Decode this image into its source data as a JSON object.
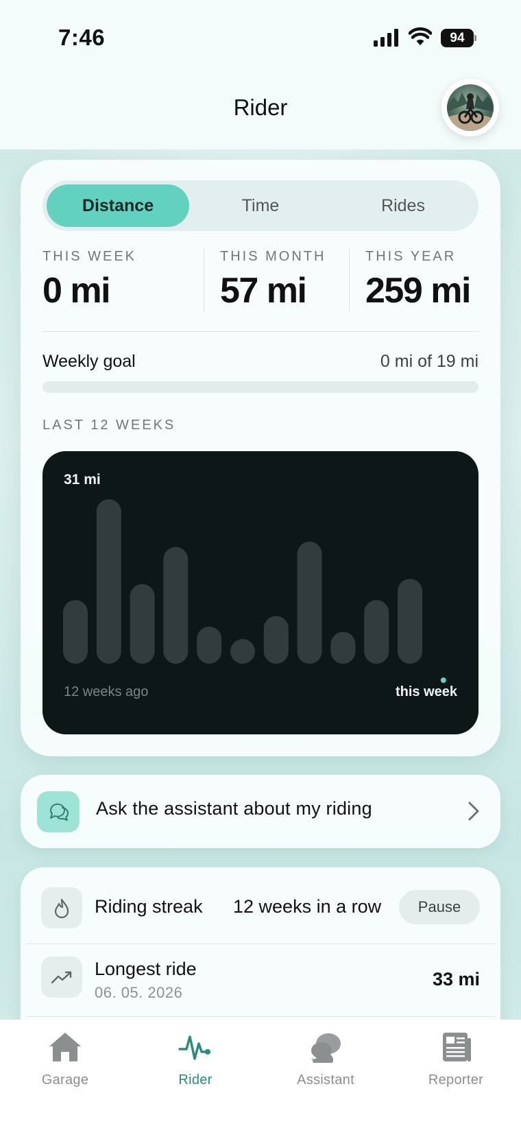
{
  "status_bar": {
    "time": "7:46",
    "battery": "94"
  },
  "header": {
    "title": "Rider"
  },
  "segments": [
    {
      "label": "Distance",
      "active": true
    },
    {
      "label": "Time",
      "active": false
    },
    {
      "label": "Rides",
      "active": false
    }
  ],
  "stats": [
    {
      "label": "THIS WEEK",
      "value": "0 mi"
    },
    {
      "label": "THIS MONTH",
      "value": "57 mi"
    },
    {
      "label": "THIS YEAR",
      "value": "259 mi"
    }
  ],
  "weekly_goal": {
    "label": "Weekly goal",
    "value": "0 mi of 19 mi",
    "progress": 0
  },
  "last_weeks": {
    "label": "LAST 12 WEEKS",
    "max_label": "31 mi",
    "start_label": "12 weeks ago",
    "end_label": "this week",
    "accent": "#62d1bf"
  },
  "chart_data": {
    "type": "bar",
    "title": "",
    "categories": [
      "12 weeks ago",
      "",
      "",
      "",
      "",
      "",
      "",
      "",
      "",
      "",
      "",
      "",
      "this week"
    ],
    "values": [
      12,
      31,
      15,
      22,
      7,
      4,
      9,
      23,
      6,
      12,
      16,
      0
    ],
    "ylim": [
      0,
      31
    ],
    "ylabel": "mi",
    "grid": false
  },
  "assistant_card": {
    "label": "Ask the assistant about my riding"
  },
  "streak": {
    "label": "Riding streak",
    "value": "12 weeks in a row",
    "button": "Pause"
  },
  "longest_ride": {
    "label": "Longest ride",
    "date": "06. 05. 2026",
    "value": "33 mi"
  },
  "tabs": [
    {
      "label": "Garage",
      "icon": "house-icon",
      "active": false
    },
    {
      "label": "Rider",
      "icon": "pulse-icon",
      "active": true
    },
    {
      "label": "Assistant",
      "icon": "chat-bubbles-icon",
      "active": false
    },
    {
      "label": "Reporter",
      "icon": "newspaper-icon",
      "active": false
    }
  ]
}
